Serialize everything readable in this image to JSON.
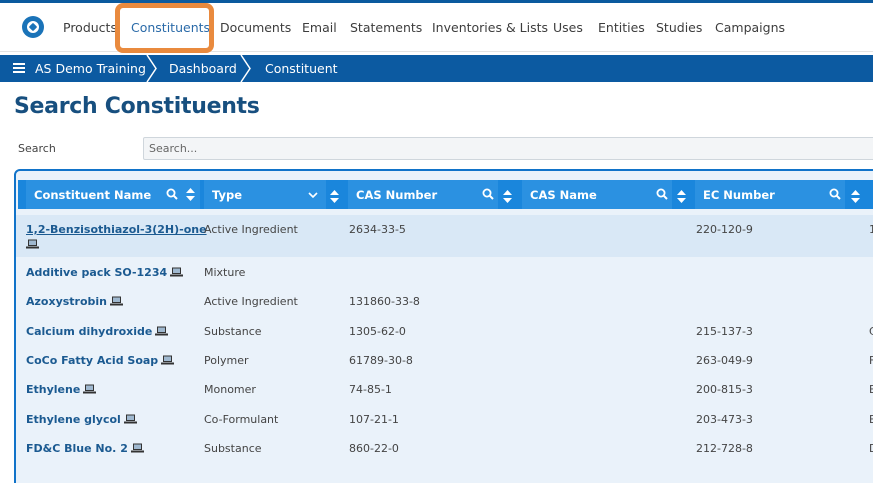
{
  "nav": {
    "items": [
      "Products",
      "Constituents",
      "Documents",
      "Email",
      "Statements",
      "Inventories & Lists",
      "Uses",
      "Entities",
      "Studies",
      "Campaigns"
    ],
    "active": "Constituents"
  },
  "breadcrumb": [
    "AS Demo Training",
    "Dashboard",
    "Constituent"
  ],
  "page": {
    "title": "Search Constituents"
  },
  "search": {
    "label": "Search",
    "placeholder": "Search..."
  },
  "table": {
    "columns": [
      "Constituent Name",
      "Type",
      "CAS Number",
      "CAS Name",
      "EC Number"
    ],
    "rows": [
      {
        "name": "1,2-Benzisothiazol-3(2H)-one",
        "type": "Active Ingredient",
        "cas": "2634-33-5",
        "cas_name": "",
        "ec": "220-120-9",
        "extra": "1",
        "selected": true
      },
      {
        "name": "Additive pack SO-1234",
        "type": "Mixture",
        "cas": "",
        "cas_name": "",
        "ec": "",
        "extra": ""
      },
      {
        "name": "Azoxystrobin",
        "type": "Active Ingredient",
        "cas": "131860-33-8",
        "cas_name": "",
        "ec": "",
        "extra": ""
      },
      {
        "name": "Calcium dihydroxide",
        "type": "Substance",
        "cas": "1305-62-0",
        "cas_name": "",
        "ec": "215-137-3",
        "extra": "C"
      },
      {
        "name": "CoCo Fatty Acid Soap",
        "type": "Polymer",
        "cas": "61789-30-8",
        "cas_name": "",
        "ec": "263-049-9",
        "extra": "F"
      },
      {
        "name": "Ethylene",
        "type": "Monomer",
        "cas": "74-85-1",
        "cas_name": "",
        "ec": "200-815-3",
        "extra": "E"
      },
      {
        "name": "Ethylene glycol",
        "type": "Co-Formulant",
        "cas": "107-21-1",
        "cas_name": "",
        "ec": "203-473-3",
        "extra": "E"
      },
      {
        "name": "FD&C Blue No. 2",
        "type": "Substance",
        "cas": "860-22-0",
        "cas_name": "",
        "ec": "212-728-8",
        "extra": "D"
      }
    ]
  },
  "icons": {
    "logo": "app-logo-icon",
    "menu": "hamburger-menu-icon",
    "search": "search-icon",
    "sort": "sort-icon",
    "filter": "chevron-down-icon",
    "computer": "laptop-icon"
  },
  "colors": {
    "accent": "#0c5aa1",
    "header": "#2b91e1",
    "title": "#174f7f",
    "highlight": "#e98a3e",
    "selected_row": "#d9e8f6"
  }
}
